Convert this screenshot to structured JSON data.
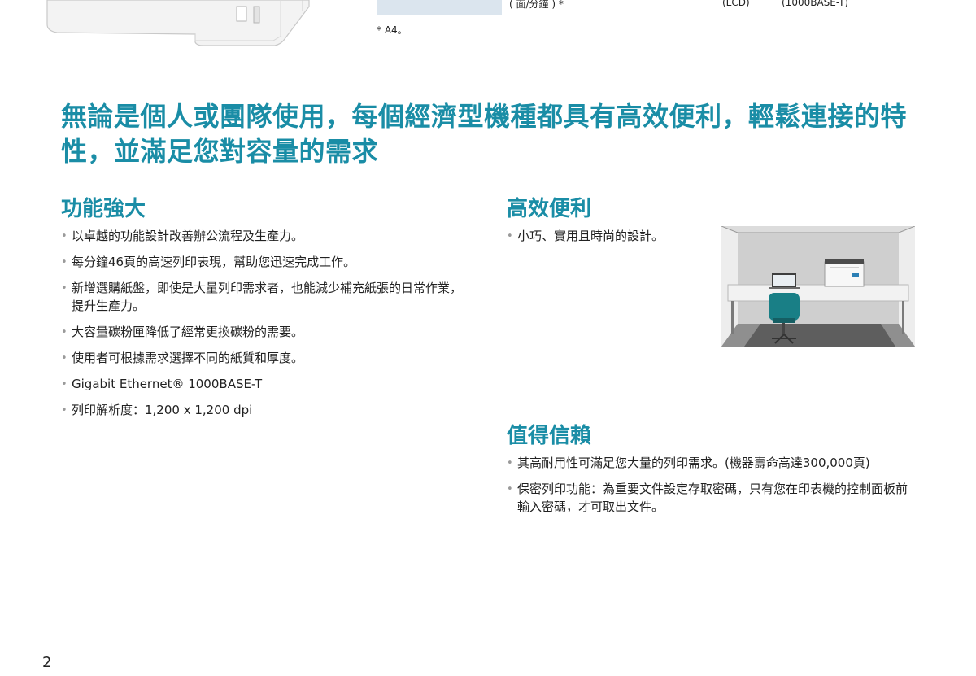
{
  "spec_table": {
    "row_label": "( 面/分鐘 ) *",
    "cell_2": "(LCD)",
    "cell_3": "(1000BASE-T)"
  },
  "footnote": "* A4。",
  "headline": "無論是個人或團隊使用，每個經濟型機種都具有高效便利，輕鬆連接的特性，並滿足您對容量的需求",
  "sections": {
    "powerful": {
      "title": "功能強大",
      "items": [
        "以卓越的功能設計改善辦公流程及生產力。",
        "每分鐘46頁的高速列印表現，幫助您迅速完成工作。",
        "新增選購紙盤，即使是大量列印需求者，也能減少補充紙張的日常作業，提升生產力。",
        "大容量碳粉匣降低了經常更換碳粉的需要。",
        "使用者可根據需求選擇不同的紙質和厚度。",
        "Gigabit Ethernet® 1000BASE-T",
        "列印解析度：1,200 x 1,200 dpi"
      ]
    },
    "efficient": {
      "title": "高效便利",
      "items": [
        "小巧、實用且時尚的設計。"
      ]
    },
    "reliable": {
      "title": "值得信賴",
      "items": [
        "其高耐用性可滿足您大量的列印需求。(機器壽命高達300,000頁)",
        "保密列印功能：為重要文件設定存取密碼，只有您在印表機的控制面板前輸入密碼，才可取出文件。"
      ]
    }
  },
  "page_number": "2",
  "colors": {
    "accent": "#1a8da6",
    "table_fill": "#dbe5ee"
  },
  "icons": {
    "bullet": "•"
  }
}
